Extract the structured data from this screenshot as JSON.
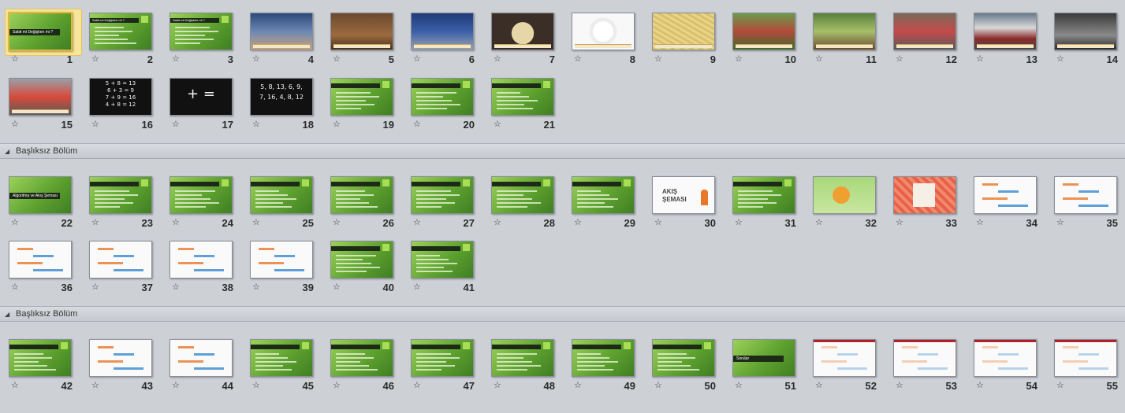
{
  "sections": [
    {
      "name": "Başlıksız Bölüm"
    },
    {
      "name": "Başlıksız Bölüm"
    }
  ],
  "slides": [
    {
      "number": "1",
      "title": "Sabit mi Değişken mi ?",
      "style": "green-title"
    },
    {
      "number": "2",
      "title": "Sabit mi Değişken mi ?",
      "style": "green"
    },
    {
      "number": "3",
      "title": "Sabit mi Değişken mi ?",
      "style": "green"
    },
    {
      "number": "4",
      "style": "photo1"
    },
    {
      "number": "5",
      "style": "photo2"
    },
    {
      "number": "6",
      "style": "photo3"
    },
    {
      "number": "7",
      "style": "food"
    },
    {
      "number": "8",
      "style": "plate"
    },
    {
      "number": "9",
      "style": "pasta"
    },
    {
      "number": "10",
      "style": "park1"
    },
    {
      "number": "11",
      "style": "park2"
    },
    {
      "number": "12",
      "style": "crowd"
    },
    {
      "number": "13",
      "style": "traffic"
    },
    {
      "number": "14",
      "style": "street"
    },
    {
      "number": "15",
      "style": "walk"
    },
    {
      "number": "16",
      "style": "black-math",
      "lines": [
        "5 + 8 = 13",
        "6 + 3 = 9",
        "7 + 9 = 16",
        "4 + 8 = 12"
      ]
    },
    {
      "number": "17",
      "style": "black-plus",
      "glyph": "+ ="
    },
    {
      "number": "18",
      "style": "black-seq",
      "lines": [
        "5, 8, 13, 6, 9,",
        "7, 16, 4, 8, 12"
      ]
    },
    {
      "number": "19",
      "style": "green"
    },
    {
      "number": "20",
      "style": "green"
    },
    {
      "number": "21",
      "style": "green"
    },
    {
      "number": "22",
      "title": "Algoritma ve Akış Şeması",
      "style": "green-title"
    },
    {
      "number": "23",
      "style": "green"
    },
    {
      "number": "24",
      "style": "green"
    },
    {
      "number": "25",
      "style": "green"
    },
    {
      "number": "26",
      "style": "green"
    },
    {
      "number": "27",
      "style": "green"
    },
    {
      "number": "28",
      "style": "green"
    },
    {
      "number": "29",
      "style": "green"
    },
    {
      "number": "30",
      "style": "white-akis",
      "text": "AKIŞ ŞEMASI"
    },
    {
      "number": "31",
      "style": "green"
    },
    {
      "number": "32",
      "style": "poster-green"
    },
    {
      "number": "33",
      "style": "poster-red"
    },
    {
      "number": "34",
      "style": "white"
    },
    {
      "number": "35",
      "style": "white"
    },
    {
      "number": "36",
      "style": "white"
    },
    {
      "number": "37",
      "style": "white"
    },
    {
      "number": "38",
      "style": "white"
    },
    {
      "number": "39",
      "style": "white"
    },
    {
      "number": "40",
      "style": "green"
    },
    {
      "number": "41",
      "style": "green"
    },
    {
      "number": "42",
      "style": "green"
    },
    {
      "number": "43",
      "style": "white"
    },
    {
      "number": "44",
      "style": "white"
    },
    {
      "number": "45",
      "style": "green"
    },
    {
      "number": "46",
      "style": "green"
    },
    {
      "number": "47",
      "style": "green"
    },
    {
      "number": "48",
      "style": "green"
    },
    {
      "number": "49",
      "style": "green"
    },
    {
      "number": "50",
      "style": "green"
    },
    {
      "number": "51",
      "title": "Sorular",
      "style": "green-title"
    },
    {
      "number": "52",
      "style": "white-red"
    },
    {
      "number": "53",
      "style": "white-red"
    },
    {
      "number": "54",
      "style": "white-red"
    },
    {
      "number": "55",
      "style": "white-red"
    }
  ],
  "icons": {
    "star": "star-icon",
    "collapse": "collapse-triangle-icon"
  }
}
